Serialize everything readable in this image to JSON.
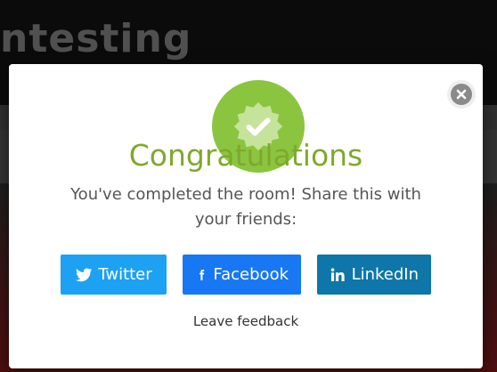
{
  "background": {
    "title_fragment": "ntesting"
  },
  "modal": {
    "title": "Congratulations",
    "message": "You've completed the room! Share this with your friends:",
    "share_buttons": [
      {
        "label": "Twitter",
        "icon": "twitter-bird-icon",
        "color": "#1da1f2"
      },
      {
        "label": "Facebook",
        "icon": "facebook-f-icon",
        "color": "#1877f2"
      },
      {
        "label": "LinkedIn",
        "icon": "linkedin-in-icon",
        "color": "#0e76a8"
      }
    ],
    "feedback_link": "Leave feedback",
    "badge_icon": "verified-check-icon",
    "badge_color": "#8bc53f",
    "title_color": "#7fa82e",
    "close_icon": "close-icon"
  }
}
